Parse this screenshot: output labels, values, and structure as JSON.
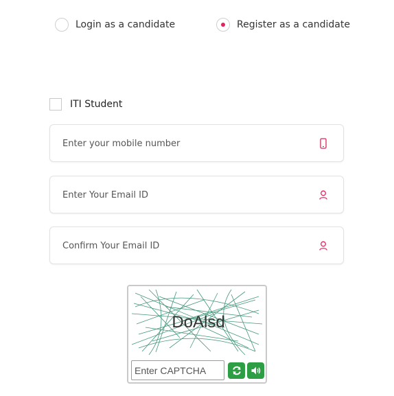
{
  "login_mode": {
    "options": [
      {
        "label": "Login as a candidate",
        "selected": false
      },
      {
        "label": "Register as a candidate",
        "selected": true
      }
    ]
  },
  "iti_student": {
    "label": "ITI Student",
    "checked": false
  },
  "fields": {
    "mobile": {
      "placeholder": "Enter your mobile number",
      "icon": "mobile-phone-icon"
    },
    "email": {
      "placeholder": "Enter Your Email ID",
      "icon": "user-icon"
    },
    "confirm_email": {
      "placeholder": "Confirm Your Email ID",
      "icon": "user-icon"
    }
  },
  "captcha": {
    "text": "DoAlsd",
    "input_placeholder": "Enter CAPTCHA",
    "refresh_icon": "refresh-icon",
    "audio_icon": "speaker-icon"
  },
  "colors": {
    "accent": "#e0245e",
    "captcha_button": "#2e9e44",
    "captcha_noise": "#2e8b6a"
  }
}
